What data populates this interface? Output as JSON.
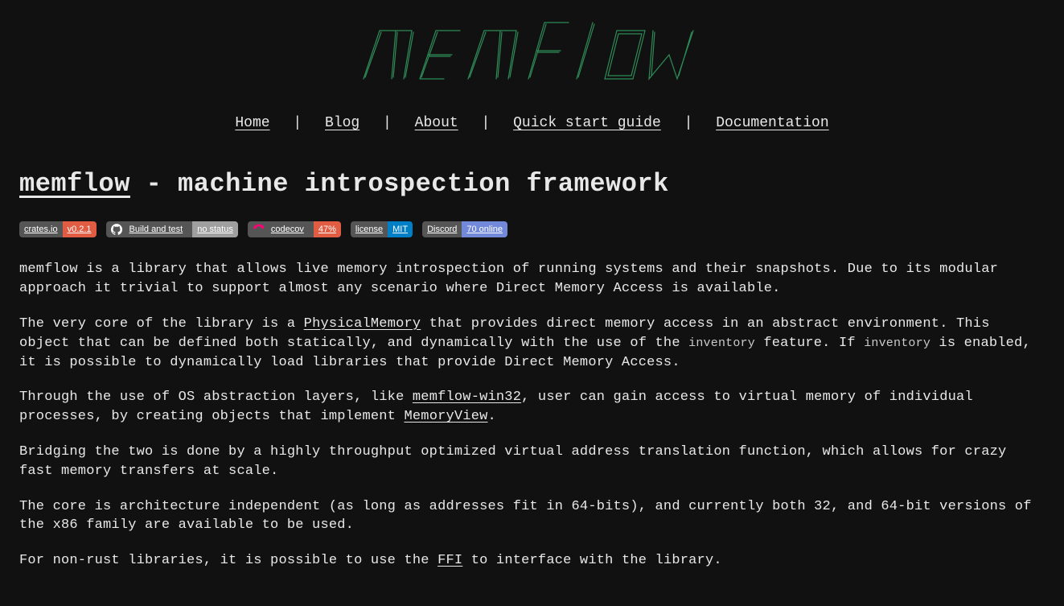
{
  "logo_text": "memflow",
  "nav": {
    "items": [
      {
        "label": "Home"
      },
      {
        "label": "Blog"
      },
      {
        "label": "About"
      },
      {
        "label": "Quick start guide"
      },
      {
        "label": "Documentation"
      }
    ],
    "sep": "|"
  },
  "heading": {
    "link": "memflow",
    "rest": " - machine introspection framework"
  },
  "badges": [
    {
      "left": "crates.io",
      "right": "v0.2.1",
      "right_class": "right-orange",
      "icon": null
    },
    {
      "left": "Build and test",
      "right": "no status",
      "right_class": "right-gray",
      "icon": "github"
    },
    {
      "left": "codecov",
      "right": "47%",
      "right_class": "right-red",
      "icon": "codecov"
    },
    {
      "left": "license",
      "right": "MIT",
      "right_class": "right-blue",
      "icon": null
    },
    {
      "left": "Discord",
      "right": "70 online",
      "right_class": "right-indigo",
      "icon": null
    }
  ],
  "paragraphs": {
    "p1": "memflow is a library that allows live memory introspection of running systems and their snapshots. Due to its modular approach it trivial to support almost any scenario where Direct Memory Access is available.",
    "p2a": "The very core of the library is a ",
    "p2_link1": "PhysicalMemory",
    "p2b": " that provides direct memory access in an abstract environment. This object that can be defined both statically, and dynamically with the use of the ",
    "p2_code1": "inventory",
    "p2c": " feature. If ",
    "p2_code2": "inventory",
    "p2d": " is enabled, it is possible to dynamically load libraries that provide Direct Memory Access.",
    "p3a": "Through the use of OS abstraction layers, like ",
    "p3_link1": "memflow-win32",
    "p3b": ", user can gain access to virtual memory of individual processes, by creating objects that implement ",
    "p3_link2": "MemoryView",
    "p3c": ".",
    "p4": "Bridging the two is done by a highly throughput optimized virtual address translation function, which allows for crazy fast memory transfers at scale.",
    "p5": "The core is architecture independent (as long as addresses fit in 64-bits), and currently both 32, and 64-bit versions of the x86 family are available to be used.",
    "p6a": "For non-rust libraries, it is possible to use the ",
    "p6_link1": "FFI",
    "p6b": " to interface with the library."
  }
}
